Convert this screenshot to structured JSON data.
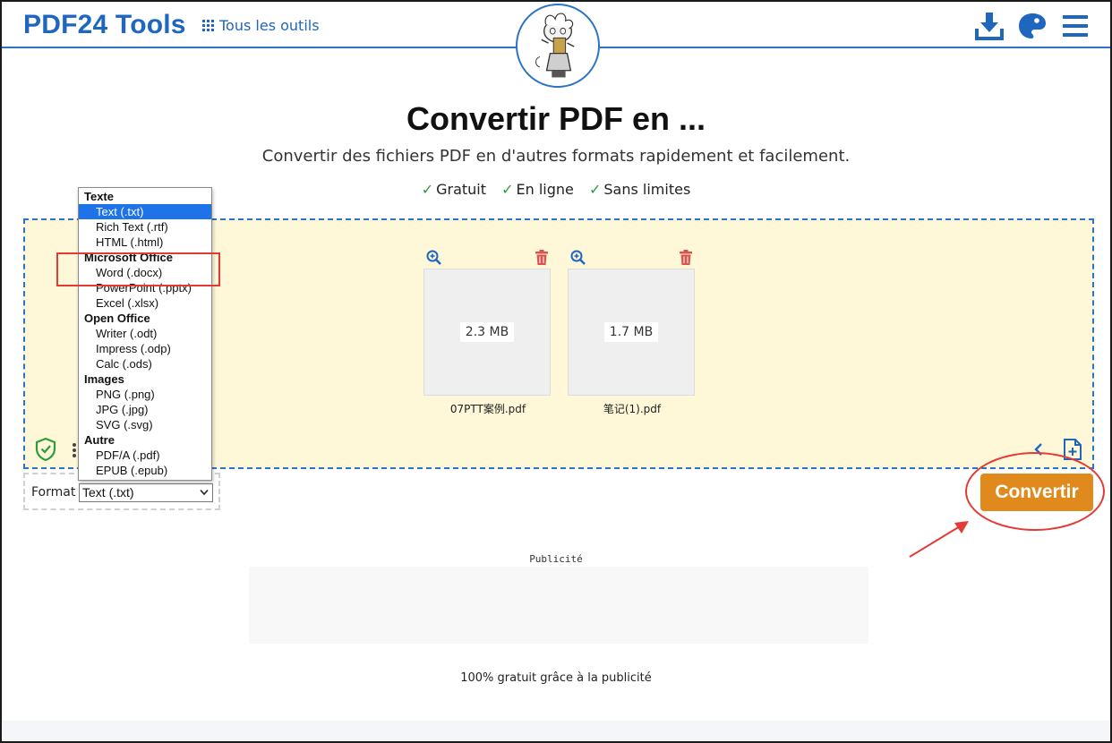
{
  "header": {
    "logo": "PDF24 Tools",
    "all_tools": "Tous les outils"
  },
  "hero": {
    "title": "Convertir PDF en ...",
    "subtitle": "Convertir des fichiers PDF en d'autres formats rapidement et facilement.",
    "features": [
      "Gratuit",
      "En ligne",
      "Sans limites"
    ]
  },
  "files": [
    {
      "name": "07PTT案例.pdf",
      "size": "2.3 MB"
    },
    {
      "name": "笔记(1).pdf",
      "size": "1.7 MB"
    }
  ],
  "format": {
    "label": "Format",
    "selected": "Text (.txt)",
    "groups": [
      {
        "label": "Texte",
        "options": [
          "Text (.txt)",
          "Rich Text (.rtf)",
          "HTML (.html)"
        ]
      },
      {
        "label": "Microsoft Office",
        "options": [
          "Word (.docx)",
          "PowerPoint (.pptx)",
          "Excel (.xlsx)"
        ]
      },
      {
        "label": "Open Office",
        "options": [
          "Writer (.odt)",
          "Impress (.odp)",
          "Calc (.ods)"
        ]
      },
      {
        "label": "Images",
        "options": [
          "PNG (.png)",
          "JPG (.jpg)",
          "SVG (.svg)"
        ]
      },
      {
        "label": "Autre",
        "options": [
          "PDF/A (.pdf)",
          "EPUB (.epub)"
        ]
      }
    ]
  },
  "convert_label": "Convertir",
  "ad": {
    "label": "Publicité",
    "footer": "100% gratuit grâce à la publicité"
  },
  "colors": {
    "brand_blue": "#1f66bf",
    "convert_orange": "#e08a1e",
    "dropzone_bg": "#fef8d8",
    "annotation_red": "#e53935",
    "selected_option": "#1e73e8"
  }
}
